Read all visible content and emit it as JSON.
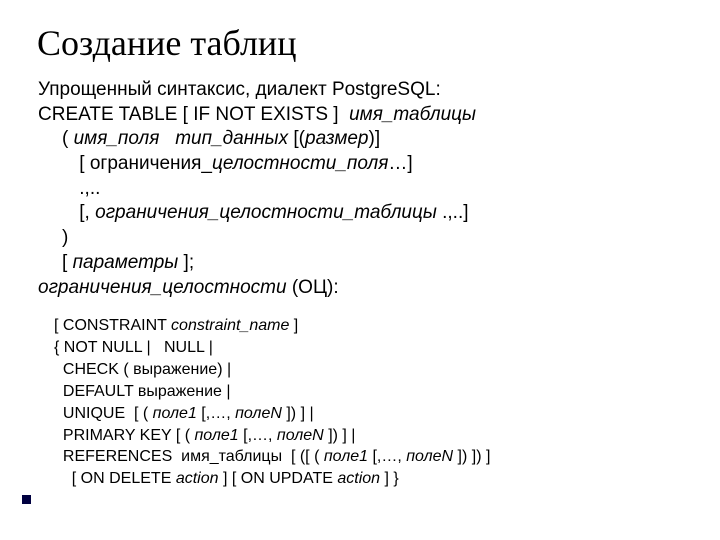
{
  "title": "Создание таблиц",
  "intro": "Упрощенный синтаксис, диалект PostgreSQL:",
  "create": {
    "kw1": "CREATE TABLE [ IF NOT EXISTS ]  ",
    "tbl": "имя_таблицы",
    "l2a": "( ",
    "l2b": "имя_поля   тип_данных ",
    "l2c": "[(",
    "l2d": "размер",
    "l2e": ")]",
    "l3a": " [ ограничения_",
    "l3b": "целостности_поля",
    "l3c": "…]",
    "l4": " .,..",
    "l5a": " [, ",
    "l5b": "ограничения_целостности_таблицы",
    "l5c": " .,..]",
    "l6": ")",
    "l7a": "[ ",
    "l7b": "параметры ",
    "l7c": "];"
  },
  "oc_head_a": "ограничения_целостности",
  "oc_head_b": " (ОЦ):",
  "oc": {
    "l1a": "[ CONSTRAINT ",
    "l1b": "constraint_name",
    "l1c": " ]",
    "l2": "{ NOT NULL |   NULL |",
    "l3": "  CHECK ( выражение) |",
    "l4": "  DEFAULT выражение |",
    "l5a": "  UNIQUE  [ ( ",
    "l5b": "поле1 ",
    "l5c": "[,…, ",
    "l5d": "полеN ",
    "l5e": "]) ] |",
    "l6a": "  PRIMARY KEY [ ( ",
    "l6b": "поле1 ",
    "l6c": "[,…, ",
    "l6d": "полеN ",
    "l6e": "]) ] |",
    "l7a": "  REFERENCES  имя_таблицы  [ ([ ( ",
    "l7b": "поле1 ",
    "l7c": "[,…, ",
    "l7d": "полеN ",
    "l7e": "]) ]) ]",
    "l8a": "    [ ON DELETE ",
    "l8b": "action",
    "l8c": " ] [ ON UPDATE ",
    "l8d": "action",
    "l8e": " ] }"
  }
}
